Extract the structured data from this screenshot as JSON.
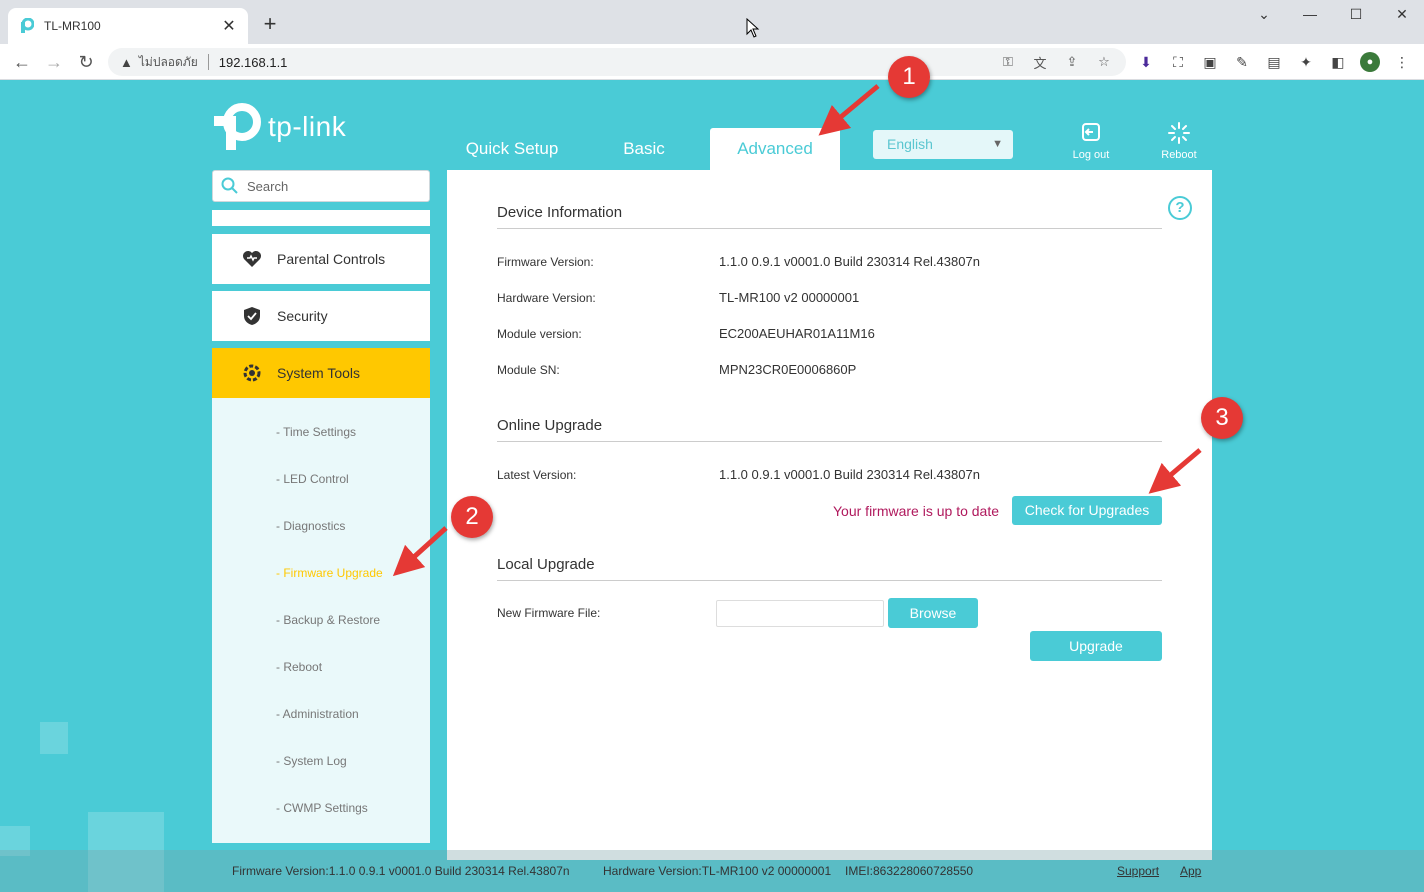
{
  "browser": {
    "tab_title": "TL-MR100",
    "address": {
      "insecure_label": "ไม่ปลอดภัย",
      "url": "192.168.1.1"
    }
  },
  "router": {
    "brand": "tp-link",
    "nav": [
      "Quick Setup",
      "Basic",
      "Advanced"
    ],
    "active_nav": "Advanced",
    "language": "English",
    "logout_label": "Log out",
    "reboot_label": "Reboot",
    "search_placeholder": "Search",
    "menu": [
      {
        "label": "Parental Controls",
        "icon": "heart-icon"
      },
      {
        "label": "Security",
        "icon": "shield-icon"
      },
      {
        "label": "System Tools",
        "icon": "gear-icon",
        "active": true
      }
    ],
    "submenu": [
      "- Time Settings",
      "- LED Control",
      "- Diagnostics",
      "- Firmware Upgrade",
      "- Backup & Restore",
      "- Reboot",
      "- Administration",
      "- System Log",
      "- CWMP Settings"
    ],
    "active_submenu": "- Firmware Upgrade",
    "device_info": {
      "title": "Device Information",
      "rows": [
        {
          "label": "Firmware Version:",
          "value": "1.1.0 0.9.1 v0001.0 Build 230314 Rel.43807n"
        },
        {
          "label": "Hardware Version:",
          "value": "TL-MR100 v2 00000001"
        },
        {
          "label": "Module version:",
          "value": "EC200AEUHAR01A11M16"
        },
        {
          "label": "Module SN:",
          "value": "MPN23CR0E0006860P"
        }
      ]
    },
    "online_upgrade": {
      "title": "Online Upgrade",
      "latest_label": "Latest Version:",
      "latest_value": "1.1.0 0.9.1 v0001.0 Build 230314 Rel.43807n",
      "status": "Your firmware is up to date",
      "check_button": "Check for Upgrades"
    },
    "local_upgrade": {
      "title": "Local Upgrade",
      "file_label": "New Firmware File:",
      "browse_button": "Browse",
      "upgrade_button": "Upgrade"
    },
    "footer": {
      "firmware": "Firmware Version:1.1.0 0.9.1 v0001.0 Build 230314 Rel.43807n",
      "hardware": "Hardware Version:TL-MR100 v2 00000001",
      "imei": "IMEI:863228060728550",
      "support": "Support",
      "app": "App"
    }
  },
  "annotations": [
    "1",
    "2",
    "3"
  ],
  "colors": {
    "accent": "#4acbd6",
    "active_menu": "#ffc800",
    "status_text": "#b0195d",
    "badge": "#e53935"
  }
}
